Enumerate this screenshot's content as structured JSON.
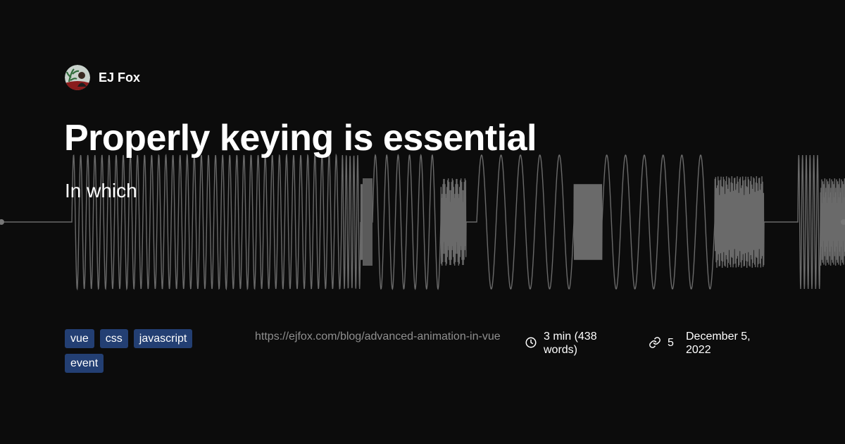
{
  "author": {
    "name": "EJ Fox"
  },
  "post": {
    "title": "Properly keying is essential",
    "subtitle": "In which",
    "tags": [
      "vue",
      "css",
      "javascript",
      "event"
    ],
    "url": "https://ejfox.com/blog/advanced-animation-in-vue",
    "reading_time": "3 min (438 words)",
    "link_count": "5",
    "date": "December 5, 2022"
  },
  "icons": {
    "reading_time": "clock-icon",
    "links": "link-icon"
  },
  "colors": {
    "background": "#0c0c0c",
    "wave": "#6a6a6a",
    "tag_background": "#233f73",
    "url_text": "#8f8f8f"
  }
}
